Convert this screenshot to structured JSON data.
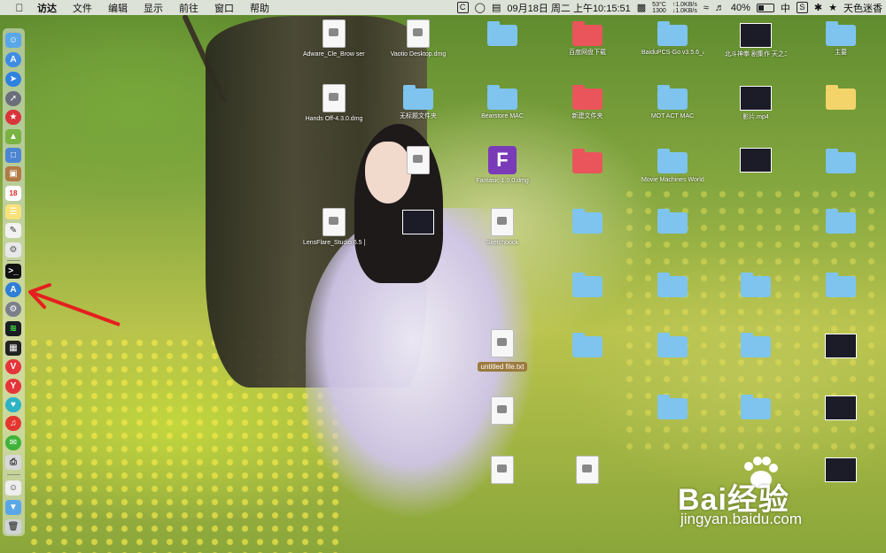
{
  "menubar": {
    "apple_icon": "apple-icon",
    "items": [
      "访达",
      "文件",
      "编辑",
      "显示",
      "前往",
      "窗口",
      "帮助"
    ],
    "status": {
      "temp": "53°C",
      "fan": "1300",
      "net_up": "↑1.0KB/s",
      "net_down": "↓1.0KB/s",
      "datetime": "09月18日 周二 上午10:15:51",
      "battery": "40%",
      "battery_level": 0.4,
      "input_method": "中",
      "user": "天色迷香"
    }
  },
  "dock": {
    "icons": [
      "finder",
      "appstore",
      "safari",
      "launchpad",
      "app-red",
      "android",
      "preview",
      "notes-brown",
      "calendar",
      "notes",
      "textedit",
      "ae",
      "terminal",
      "xcode-a",
      "settings",
      "activity",
      "terminal2",
      "vivaldi",
      "yandex",
      "app-teal",
      "netease",
      "wechat",
      "printer",
      "photo",
      "downloads-folder",
      "trash"
    ],
    "calendar_day": "18"
  },
  "desktop_icons": [
    {
      "label": "Adware_Cle_Brow ser Clea...NT).dmg",
      "kind": "doc"
    },
    {
      "label": "Vaotio Desktop.dmg",
      "kind": "doc"
    },
    {
      "label": "",
      "kind": "folder"
    },
    {
      "label": "",
      "kind": "folder-red"
    },
    {
      "label": "",
      "kind": "folder"
    },
    {
      "label": "",
      "kind": "thumb"
    },
    {
      "label": "",
      "kind": "folder"
    },
    {
      "label": "百度网盘下载",
      "kind": "folder-red"
    },
    {
      "label": "BaiduPCS-Go v3.5.6_amd64",
      "kind": "folder"
    },
    {
      "label": "北斗神拳 剧集作 天之二 X480.mp4",
      "kind": "thumb"
    },
    {
      "label": "主要",
      "kind": "folder"
    },
    {
      "label": "Hands Off-4.3.0.dmg",
      "kind": "doc"
    },
    {
      "label": "无标题文件夹",
      "kind": "folder"
    },
    {
      "label": "Bearstore MAC",
      "kind": "folder"
    },
    {
      "label": "新建文件夹",
      "kind": "folder-red"
    },
    {
      "label": "MOT ACT MAC",
      "kind": "folder"
    },
    {
      "label": "影片.mp4",
      "kind": "thumb"
    },
    {
      "label": "",
      "kind": "folder-yellow"
    },
    {
      "label": "",
      "kind": "doc"
    },
    {
      "label": "Fantasic 1.0.0.dmg",
      "kind": "purple"
    },
    {
      "label": "",
      "kind": "folder-red"
    },
    {
      "label": "Movie Machines World ACTIVATED",
      "kind": "folder"
    },
    {
      "label": "",
      "kind": "thumb"
    },
    {
      "label": "",
      "kind": "folder"
    },
    {
      "label": "LensFlare_Studio 6.5 [TNT].dmg",
      "kind": "doc"
    },
    {
      "label": "",
      "kind": "thumb"
    },
    {
      "label": "Sketchbook",
      "kind": "doc"
    },
    {
      "label": "",
      "kind": "folder"
    },
    {
      "label": "",
      "kind": "folder"
    },
    {
      "label": "",
      "kind": "thumb"
    },
    {
      "label": "",
      "kind": "folder"
    },
    {
      "label": "untitled file.txt",
      "kind": "doc"
    }
  ],
  "untitled_label": "untitled file.txt",
  "watermark": {
    "brand": "Bai经验",
    "url": "jingyan.baidu.com"
  }
}
